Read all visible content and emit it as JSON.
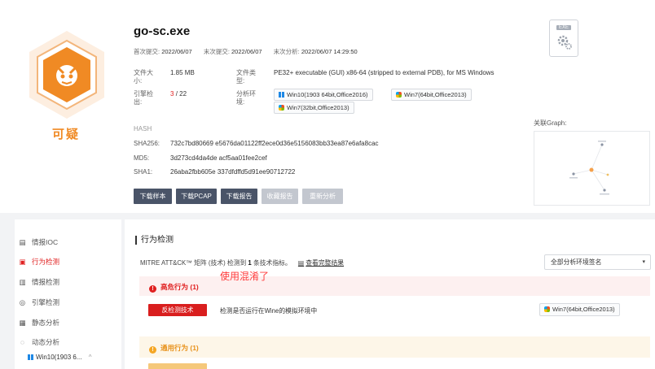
{
  "file": {
    "name": "go-sc.exe",
    "verdict": "可疑",
    "first_submit_label": "首次提交:",
    "first_submit": "2022/06/07",
    "last_submit_label": "末次提交:",
    "last_submit": "2022/06/07",
    "last_analysis_label": "末次分析:",
    "last_analysis": "2022/06/07 14:29:50",
    "size_label": "文件大小:",
    "size": "1.85 MB",
    "type_label": "文件类型:",
    "type": "PE32+ executable (GUI) x86-64 (stripped to external PDB), for MS Windows",
    "engine_label": "引擎检出:",
    "engine_hits": "3",
    "engine_total": "/ 22",
    "env_label": "分析环境:",
    "envs": [
      "Win10(1903 64bit,Office2016)",
      "Win7(64bit,Office2013)",
      "Win7(32bit,Office2013)"
    ],
    "file_icon_tag": "EXE"
  },
  "hash": {
    "section_label": "HASH",
    "sha256_label": "SHA256:",
    "sha256": "732c7bd80669 e5676da01122ff2ece0d36e5156083bb33ea87e6afa8cac",
    "md5_label": "MD5:",
    "md5": "3d273cd4da4de acf5aa01fee2cef",
    "sha1_label": "SHA1:",
    "sha1": "26aba2fbb605e 337dfdffd5d91ee90712722"
  },
  "actions": [
    "下载样本",
    "下载PCAP",
    "下载报告",
    "收藏报告",
    "重新分析"
  ],
  "graph_label": "关联Graph:",
  "sidebar": {
    "items": [
      {
        "icon": "▤",
        "label": "情报IOC"
      },
      {
        "icon": "▣",
        "label": "行为检测"
      },
      {
        "icon": "▥",
        "label": "情报检测"
      },
      {
        "icon": "◎",
        "label": "引擎检测"
      },
      {
        "icon": "▦",
        "label": "静态分析"
      },
      {
        "icon": "◌",
        "label": "动态分析"
      }
    ],
    "sub_item": "Win10(1903 6...",
    "sub_caret": "^"
  },
  "main": {
    "title": "行为检测",
    "mitre_prefix": "MITRE ATT&CK™ 矩阵 (技术) 检测到",
    "mitre_count": "1",
    "mitre_suffix": "条技术指标。",
    "mitre_link": "查看完整结果",
    "select_value": "全部分析环境签名",
    "select_caret": "▾",
    "high_label": "高危行为 (1)",
    "high_dot": "!",
    "annotation": "使用混淆了",
    "row1_tag": "反检测技术",
    "row1_desc": "检测是否运行在Wine的模拟环境中",
    "row1_env": "Win7(64bit,Office2013)",
    "general_label": "通用行为 (1)",
    "general_dot": "!"
  },
  "colors": {
    "accent_red": "#e02020",
    "suspicious_orange": "#f08a24",
    "button_dark": "#4a5468"
  }
}
